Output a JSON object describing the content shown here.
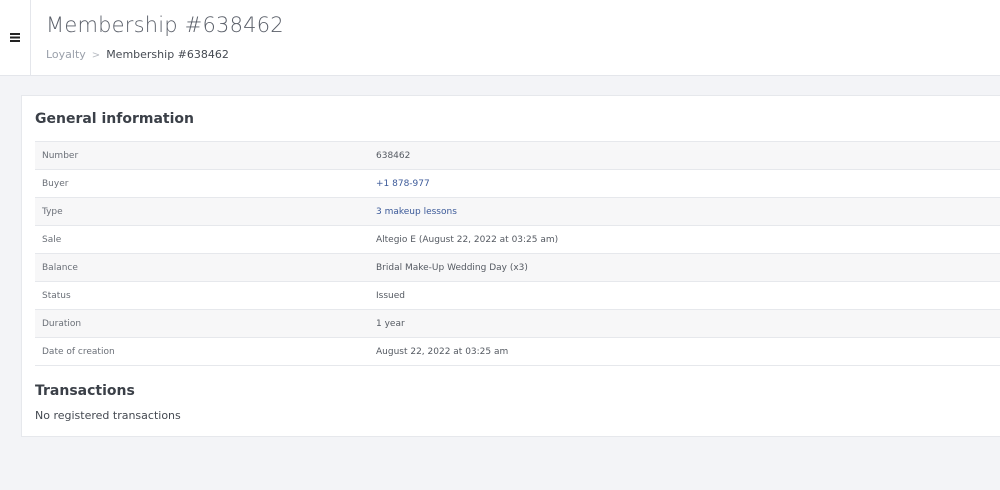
{
  "header": {
    "title": "Membership #638462",
    "breadcrumb": {
      "parent": "Loyalty",
      "separator": ">",
      "current": "Membership #638462"
    }
  },
  "general": {
    "heading": "General information",
    "rows": [
      {
        "label": "Number",
        "value": "638462"
      },
      {
        "label": "Buyer",
        "value": "+1 878-977"
      },
      {
        "label": "Type",
        "value": "3 makeup lessons"
      },
      {
        "label": "Sale",
        "value": "Altegio E (August 22, 2022 at 03:25 am)"
      },
      {
        "label": "Balance",
        "value": "Bridal Make-Up Wedding Day (x3)"
      },
      {
        "label": "Status",
        "value": "Issued"
      },
      {
        "label": "Duration",
        "value": "1 year"
      },
      {
        "label": "Date of creation",
        "value": "August 22, 2022 at 03:25 am"
      }
    ]
  },
  "transactions": {
    "heading": "Transactions",
    "empty_text": "No registered transactions"
  },
  "icons": {
    "menu": "hamburger-menu-icon"
  },
  "colors": {
    "link": "#3c5a99",
    "background": "#f3f4f7"
  }
}
